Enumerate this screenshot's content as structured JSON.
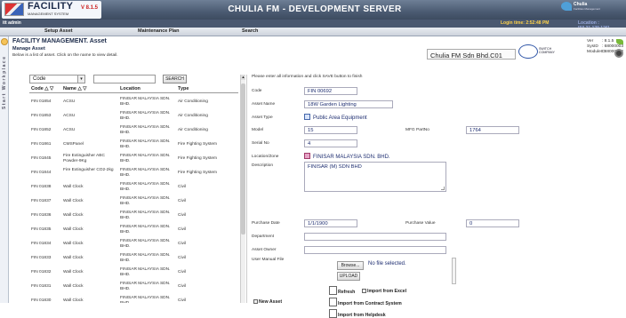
{
  "header": {
    "logo_text": "FACILITY",
    "logo_sub": "MANAGEMENT SYSTEM",
    "version": "V 8.1.5",
    "server_title": "CHULIA FM - DEVELOPMENT SERVER",
    "brand_name": "Chulia",
    "brand_sub": "Facilities Management",
    "user": "itt admin",
    "login_time": "Login time: 2:52:48 PM",
    "location": "Location : [60.31.179.126]"
  },
  "tabs": [
    "Setup Asset",
    "Maintenance Plan",
    "Search"
  ],
  "side_label": "Start Workplace",
  "page": {
    "title": "FACILITY MANAGEMENT. Asset",
    "subtitle": "Manage Asset",
    "hint": "Below is a list of asset. Click on the name to view detail.",
    "company": "Chulia FM Sdn Bhd.C01",
    "emblem_lines": [
      "SWITCH",
      "COMPANY"
    ],
    "ver_label": "Ver",
    "ver_value": ": 8.1.5",
    "sysid_label": "SysID",
    "sysid_value": ": 68000003",
    "moduleid_label": "ModuleID",
    "moduleid_value": ": 68000004"
  },
  "list": {
    "filter_selected": "Code",
    "search_button": "SEARCH",
    "columns": [
      "Code △ ▽",
      "Name △ ▽",
      "Location",
      "Type"
    ],
    "rows": [
      {
        "code": "FIN 01854",
        "name": "ACSU",
        "location": "FINISAR MALAYSIA SDN. BHD.",
        "type": "Air Conditioning"
      },
      {
        "code": "FIN 01853",
        "name": "ACSU",
        "location": "FINISAR MALAYSIA SDN. BHD.",
        "type": "Air Conditioning"
      },
      {
        "code": "FIN 01852",
        "name": "ACSU",
        "location": "FINISAR MALAYSIA SDN. BHD.",
        "type": "Air Conditioning"
      },
      {
        "code": "FIN 01861",
        "name": "CMSPanel",
        "location": "FINISAR MALAYSIA SDN. BHD.",
        "type": "Fire Fighting System"
      },
      {
        "code": "FIN 01845",
        "name": "Fire Extinguisher ABC Powder-9Kg",
        "location": "FINISAR MALAYSIA SDN. BHD.",
        "type": "Fire Fighting System"
      },
      {
        "code": "FIN 01844",
        "name": "Fire Extinguisher CO2-2kg",
        "location": "FINISAR MALAYSIA SDN. BHD.",
        "type": "Fire Fighting System"
      },
      {
        "code": "FIN 01838",
        "name": "Wall Clock",
        "location": "FINISAR MALAYSIA SDN. BHD.",
        "type": "Civil"
      },
      {
        "code": "FIN 01837",
        "name": "Wall Clock",
        "location": "FINISAR MALAYSIA SDN. BHD.",
        "type": "Civil"
      },
      {
        "code": "FIN 01836",
        "name": "Wall Clock",
        "location": "FINISAR MALAYSIA SDN. BHD.",
        "type": "Civil"
      },
      {
        "code": "FIN 01835",
        "name": "Wall Clock",
        "location": "FINISAR MALAYSIA SDN. BHD.",
        "type": "Civil"
      },
      {
        "code": "FIN 01834",
        "name": "Wall Clock",
        "location": "FINISAR MALAYSIA SDN. BHD.",
        "type": "Civil"
      },
      {
        "code": "FIN 01833",
        "name": "Wall Clock",
        "location": "FINISAR MALAYSIA SDN. BHD.",
        "type": "Civil"
      },
      {
        "code": "FIN 01832",
        "name": "Wall Clock",
        "location": "FINISAR MALAYSIA SDN. BHD.",
        "type": "Civil"
      },
      {
        "code": "FIN 01831",
        "name": "Wall Clock",
        "location": "FINISAR MALAYSIA SDN. BHD.",
        "type": "Civil"
      },
      {
        "code": "FIN 01830",
        "name": "Wall Clock",
        "location": "FINISAR MALAYSIA SDN. BHD.",
        "type": "Civil"
      }
    ]
  },
  "form": {
    "instruction": "Please enter all information and click SAVE button to finish",
    "code_label": "Code",
    "code_value": "FIN 00692",
    "asset_name_label": "Asset Name",
    "asset_name_value": "18W Garden Lighting",
    "asset_type_label": "Asset Type",
    "asset_type_value": "Public Area Equipment",
    "model_label": "Model",
    "model_value": "15",
    "mfg_label": "MFG PartNo",
    "mfg_value": "1764",
    "serial_label": "Serial No",
    "serial_value": "4",
    "location_label": "Location/Zone",
    "location_value": "FINISAR MALAYSIA SDN. BHD.",
    "description_label": "Description",
    "description_value": "FINISAR (M) SDN BHD",
    "purchase_date_label": "Purchase Date",
    "purchase_date_value": "1/1/1900",
    "purchase_value_label": "Purchase Value",
    "purchase_value_value": "0",
    "department_label": "Department",
    "department_value": "",
    "owner_label": "Asset Owner",
    "owner_value": "",
    "manual_label": "User Manual File",
    "browse_label": "Browse...",
    "nofile_text": "No file selected.",
    "upload_label": "UPLOAD",
    "refresh_label": "Refresh",
    "import_excel_label": "Import from Excel",
    "import_contract_label": "Import from Contract System",
    "import_helpdesk_label": "Import from Helpdesk",
    "new_asset_label": "New Asset"
  }
}
